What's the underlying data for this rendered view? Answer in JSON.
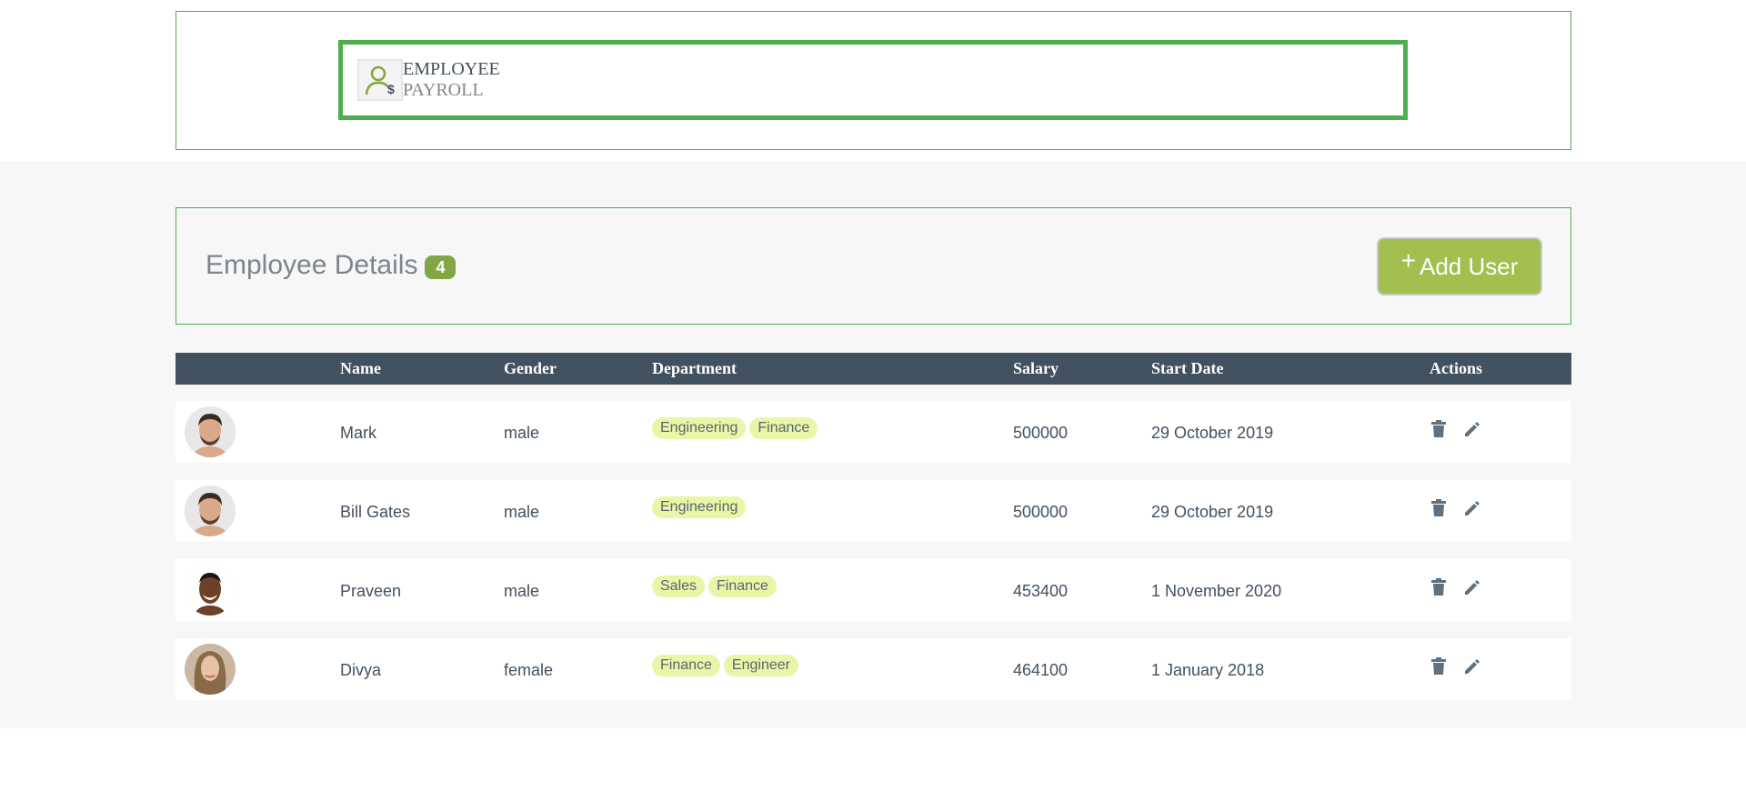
{
  "header": {
    "logo_icon": "employee-payroll-icon",
    "logo_line1": "EMPLOYEE",
    "logo_line2": "PAYROLL"
  },
  "details": {
    "title": "Employee Details",
    "count": "4",
    "add_button_icon": "plus-icon",
    "add_button_label": "Add User"
  },
  "table": {
    "columns": [
      "",
      "Name",
      "Gender",
      "Department",
      "Salary",
      "Start Date",
      "Actions"
    ],
    "rows": [
      {
        "avatar": "male-avatar",
        "name": "Mark",
        "gender": "male",
        "departments": [
          "Engineering",
          "Finance"
        ],
        "salary": "500000",
        "start_date": "29 October 2019",
        "actions": [
          "delete-icon",
          "edit-icon"
        ]
      },
      {
        "avatar": "male-avatar",
        "name": "Bill Gates",
        "gender": "male",
        "departments": [
          "Engineering"
        ],
        "salary": "500000",
        "start_date": "29 October 2019",
        "actions": [
          "delete-icon",
          "edit-icon"
        ]
      },
      {
        "avatar": "male-avatar",
        "name": "Praveen",
        "gender": "male",
        "departments": [
          "Sales",
          "Finance"
        ],
        "salary": "453400",
        "start_date": "1 November 2020",
        "actions": [
          "delete-icon",
          "edit-icon"
        ]
      },
      {
        "avatar": "female-avatar",
        "name": "Divya",
        "gender": "female",
        "departments": [
          "Finance",
          "Engineer"
        ],
        "salary": "464100",
        "start_date": "1 January 2018",
        "actions": [
          "delete-icon",
          "edit-icon"
        ]
      }
    ]
  },
  "colors": {
    "accent_green": "#4caf50",
    "button_green": "#a3bf4f",
    "badge_green": "#82a545",
    "chip_bg": "#e9f6a7",
    "table_header": "#42515f",
    "page_grey": "#f7f7f7"
  }
}
